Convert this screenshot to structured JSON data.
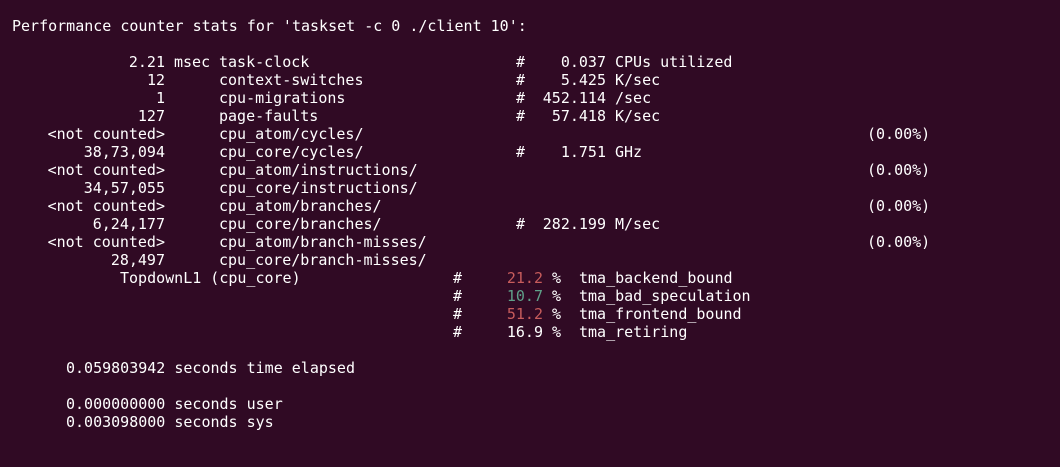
{
  "header": "Performance counter stats for 'taskset -c 0 ./client 10':",
  "colors": {
    "background": "#300a24",
    "text": "#ffffff",
    "red": "#c75c5c",
    "green": "#5fa089"
  },
  "stats": [
    {
      "value": "2.21",
      "unit": "msec",
      "event": "task-clock",
      "hash": "#",
      "metric_value": "0.037",
      "metric_unit": "CPUs utilized",
      "pct": ""
    },
    {
      "value": "12",
      "unit": "",
      "event": "context-switches",
      "hash": "#",
      "metric_value": "5.425",
      "metric_unit": "K/sec",
      "pct": ""
    },
    {
      "value": "1",
      "unit": "",
      "event": "cpu-migrations",
      "hash": "#",
      "metric_value": "452.114",
      "metric_unit": "/sec",
      "pct": ""
    },
    {
      "value": "127",
      "unit": "",
      "event": "page-faults",
      "hash": "#",
      "metric_value": "57.418",
      "metric_unit": "K/sec",
      "pct": ""
    },
    {
      "value": "<not counted>",
      "unit": "",
      "event": "cpu_atom/cycles/",
      "hash": "",
      "metric_value": "",
      "metric_unit": "",
      "pct": "(0.00%)"
    },
    {
      "value": "38,73,094",
      "unit": "",
      "event": "cpu_core/cycles/",
      "hash": "#",
      "metric_value": "1.751",
      "metric_unit": "GHz",
      "pct": ""
    },
    {
      "value": "<not counted>",
      "unit": "",
      "event": "cpu_atom/instructions/",
      "hash": "",
      "metric_value": "",
      "metric_unit": "",
      "pct": "(0.00%)"
    },
    {
      "value": "34,57,055",
      "unit": "",
      "event": "cpu_core/instructions/",
      "hash": "",
      "metric_value": "",
      "metric_unit": "",
      "pct": ""
    },
    {
      "value": "<not counted>",
      "unit": "",
      "event": "cpu_atom/branches/",
      "hash": "",
      "metric_value": "",
      "metric_unit": "",
      "pct": "(0.00%)"
    },
    {
      "value": "6,24,177",
      "unit": "",
      "event": "cpu_core/branches/",
      "hash": "#",
      "metric_value": "282.199",
      "metric_unit": "M/sec",
      "pct": ""
    },
    {
      "value": "<not counted>",
      "unit": "",
      "event": "cpu_atom/branch-misses/",
      "hash": "",
      "metric_value": "",
      "metric_unit": "",
      "pct": "(0.00%)"
    },
    {
      "value": "28,497",
      "unit": "",
      "event": "cpu_core/branch-misses/",
      "hash": "",
      "metric_value": "",
      "metric_unit": "",
      "pct": ""
    }
  ],
  "topdown": {
    "label": "TopdownL1 (cpu_core)",
    "rows": [
      {
        "hash": "#",
        "value": "21.2",
        "pct_sign": "%",
        "metric": "tma_backend_bound",
        "color": "red"
      },
      {
        "hash": "#",
        "value": "10.7",
        "pct_sign": "%",
        "metric": "tma_bad_speculation",
        "color": "green"
      },
      {
        "hash": "#",
        "value": "51.2",
        "pct_sign": "%",
        "metric": "tma_frontend_bound",
        "color": "red"
      },
      {
        "hash": "#",
        "value": "16.9",
        "pct_sign": "%",
        "metric": "tma_retiring",
        "color": ""
      }
    ]
  },
  "timing": {
    "elapsed": "0.059803942 seconds time elapsed",
    "user": "0.000000000 seconds user",
    "sys": "0.003098000 seconds sys"
  }
}
